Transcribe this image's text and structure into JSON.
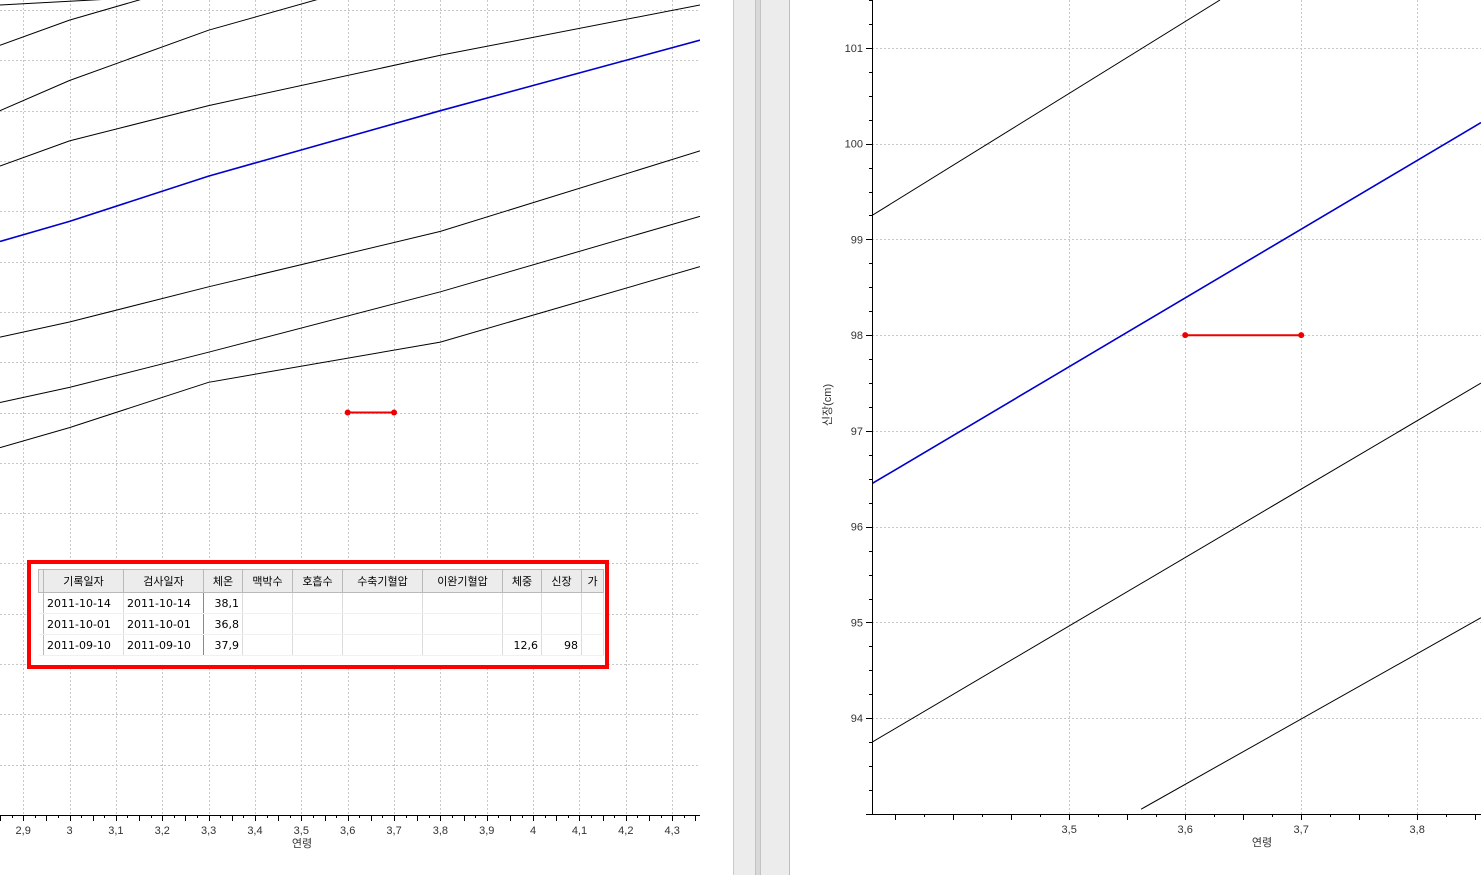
{
  "colors": {
    "median": "#0000cc",
    "percentile": "#000000",
    "measurement": "#ee0000",
    "grid": "#c8c8c8"
  },
  "chart_data": [
    {
      "type": "line",
      "xlabel": "연령",
      "xlim": [
        2.85,
        4.36
      ],
      "ylim": [
        90,
        106.2
      ],
      "x_ticks": [
        "2.9",
        "3",
        "3.1",
        "3.2",
        "3.3",
        "3.4",
        "3.5",
        "3.6",
        "3.7",
        "3.8",
        "3.9",
        "4",
        "4.1",
        "4.2",
        "4.3"
      ],
      "x_tick_values": [
        2.9,
        3.0,
        3.1,
        3.2,
        3.3,
        3.4,
        3.5,
        3.6,
        3.7,
        3.8,
        3.9,
        4.0,
        4.1,
        4.2,
        4.3
      ],
      "grid": true,
      "series": [
        {
          "role": "percentile",
          "points": [
            [
              2.85,
              106.1
            ],
            [
              3.25,
              106.3
            ]
          ]
        },
        {
          "role": "percentile",
          "points": [
            [
              2.85,
              105.3
            ],
            [
              3.0,
              105.8
            ],
            [
              3.3,
              106.6
            ],
            [
              3.85,
              108.3
            ]
          ]
        },
        {
          "role": "percentile",
          "points": [
            [
              2.85,
              104.0
            ],
            [
              3.0,
              104.6
            ],
            [
              3.3,
              105.6
            ],
            [
              3.8,
              106.9
            ],
            [
              4.36,
              108.0
            ]
          ]
        },
        {
          "role": "percentile",
          "points": [
            [
              2.85,
              102.9
            ],
            [
              3.0,
              103.4
            ],
            [
              3.3,
              104.1
            ],
            [
              3.8,
              105.1
            ],
            [
              4.36,
              106.1
            ]
          ]
        },
        {
          "role": "median",
          "points": [
            [
              2.85,
              101.4
            ],
            [
              3.0,
              101.8
            ],
            [
              3.3,
              102.7
            ],
            [
              3.8,
              104.0
            ],
            [
              4.36,
              105.4
            ]
          ]
        },
        {
          "role": "percentile",
          "points": [
            [
              2.85,
              99.5
            ],
            [
              3.0,
              99.8
            ],
            [
              3.3,
              100.5
            ],
            [
              3.8,
              101.6
            ],
            [
              4.36,
              103.2
            ]
          ]
        },
        {
          "role": "percentile",
          "points": [
            [
              2.85,
              98.2
            ],
            [
              3.0,
              98.5
            ],
            [
              3.3,
              99.2
            ],
            [
              3.8,
              100.4
            ],
            [
              4.36,
              101.9
            ]
          ]
        },
        {
          "role": "percentile",
          "points": [
            [
              2.85,
              97.3
            ],
            [
              3.0,
              97.7
            ],
            [
              3.3,
              98.6
            ],
            [
              3.8,
              99.4
            ],
            [
              4.36,
              100.9
            ]
          ]
        }
      ],
      "measurements": [
        [
          3.6,
          98
        ],
        [
          3.7,
          98
        ]
      ]
    },
    {
      "type": "line",
      "xlabel": "연령",
      "ylabel": "신장(cm)",
      "xlim": [
        3.33,
        3.855
      ],
      "ylim": [
        93.0,
        101.5
      ],
      "x_ticks": [
        "3.5",
        "3.6",
        "3.7",
        "3.8"
      ],
      "x_tick_values": [
        3.5,
        3.6,
        3.7,
        3.8
      ],
      "y_ticks": [
        "94",
        "95",
        "96",
        "97",
        "98",
        "99",
        "100",
        "101"
      ],
      "y_tick_values": [
        94,
        95,
        96,
        97,
        98,
        99,
        100,
        101
      ],
      "grid": true,
      "series": [
        {
          "role": "percentile",
          "points": [
            [
              3.33,
              99.25
            ],
            [
              3.63,
              101.5
            ]
          ]
        },
        {
          "role": "median",
          "points": [
            [
              3.33,
              96.45
            ],
            [
              3.855,
              100.22
            ]
          ]
        },
        {
          "role": "percentile",
          "points": [
            [
              3.33,
              93.75
            ],
            [
              3.855,
              97.5
            ]
          ]
        },
        {
          "role": "percentile",
          "points": [
            [
              3.562,
              93.05
            ],
            [
              3.855,
              95.05
            ]
          ]
        }
      ],
      "measurements": [
        [
          3.6,
          98
        ],
        [
          3.7,
          98
        ]
      ]
    }
  ],
  "table": {
    "headers": [
      "기록일자",
      "검사일자",
      "체온",
      "맥박수",
      "호흡수",
      "수축기혈압",
      "이완기혈압",
      "체중",
      "신장",
      "가"
    ],
    "rows": [
      [
        "2011-10-14",
        "2011-10-14",
        "38,1",
        "",
        "",
        "",
        "",
        "",
        "",
        ""
      ],
      [
        "2011-10-01",
        "2011-10-01",
        "36,8",
        "",
        "",
        "",
        "",
        "",
        "",
        ""
      ],
      [
        "2011-09-10",
        "2011-09-10",
        "37,9",
        "",
        "",
        "",
        "",
        "12,6",
        "98",
        ""
      ]
    ]
  }
}
